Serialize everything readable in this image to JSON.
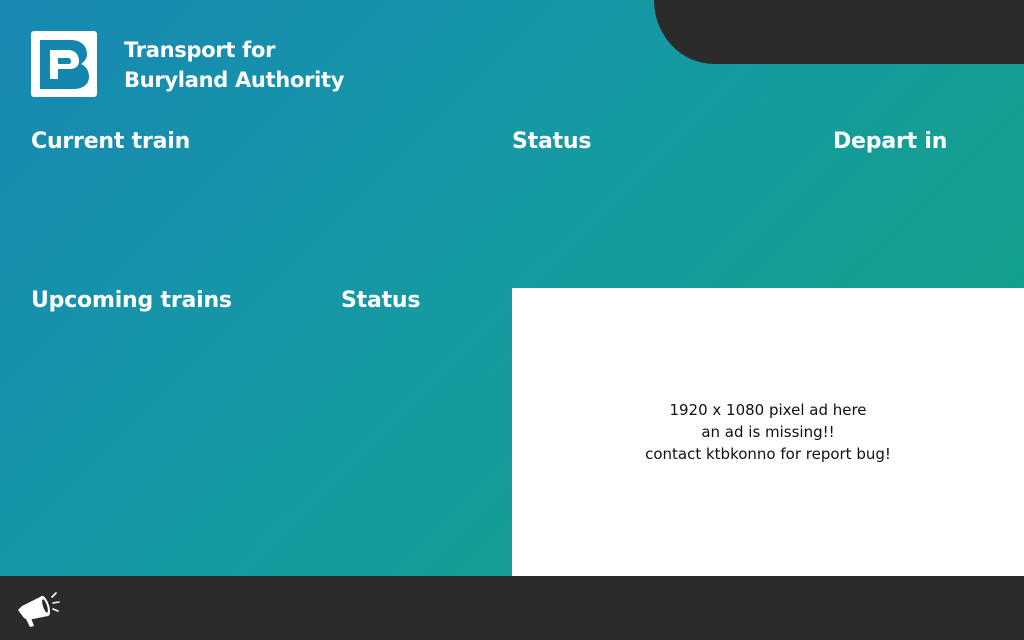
{
  "brand": {
    "line1": "Transport for",
    "line2": "Buryland Authority",
    "logo_icon": "brand-b-logo-icon"
  },
  "current": {
    "heading": "Current train",
    "status_heading": "Status",
    "depart_heading": "Depart in"
  },
  "upcoming": {
    "heading": "Upcoming trains",
    "status_heading": "Status"
  },
  "ad": {
    "lines": [
      "1920 x 1080 pixel ad here",
      "an ad is missing!!",
      "contact ktbkonno for report bug!"
    ]
  },
  "footer": {
    "icon": "megaphone-icon"
  },
  "colors": {
    "gradient_start": "#1888b4",
    "gradient_end": "#11a57f",
    "dark_bar": "#2b2b2b",
    "ad_background": "#ffffff",
    "heading_text": "#ffffff"
  }
}
